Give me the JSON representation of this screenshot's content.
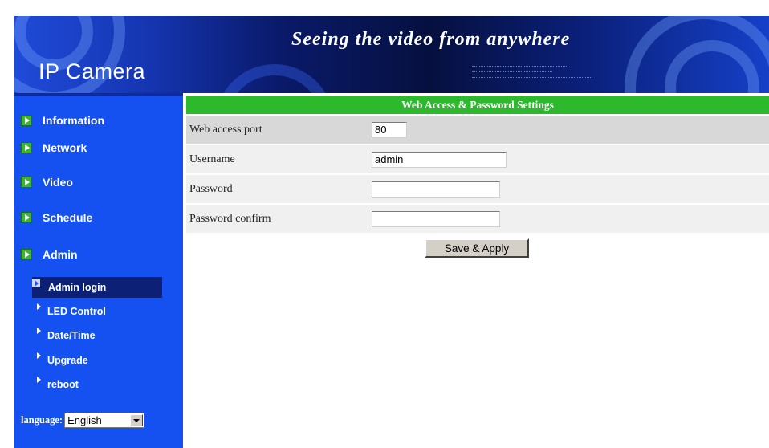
{
  "banner": {
    "logo": "IP Camera",
    "slogan": "Seeing the video from anywhere"
  },
  "sidebar": {
    "items": [
      {
        "label": "Information"
      },
      {
        "label": "Network"
      },
      {
        "label": "Video"
      },
      {
        "label": "Schedule"
      },
      {
        "label": "Admin"
      }
    ],
    "subitems": [
      {
        "label": "Admin login",
        "active": true
      },
      {
        "label": "LED Control"
      },
      {
        "label": "Date/Time"
      },
      {
        "label": "Upgrade"
      },
      {
        "label": "reboot"
      }
    ],
    "language": {
      "label": "language:",
      "selected": "English"
    }
  },
  "main": {
    "title": "Web Access & Password Settings",
    "fields": {
      "port": {
        "label": "Web access port",
        "value": "80"
      },
      "username": {
        "label": "Username",
        "value": "admin"
      },
      "password": {
        "label": "Password",
        "value": ""
      },
      "password_confirm": {
        "label": "Password confirm",
        "value": ""
      }
    },
    "save_label": "Save & Apply"
  },
  "colors": {
    "sidebar": "#1451f0",
    "title_bar": "#2cba2c",
    "active_subitem": "#0c2176"
  }
}
